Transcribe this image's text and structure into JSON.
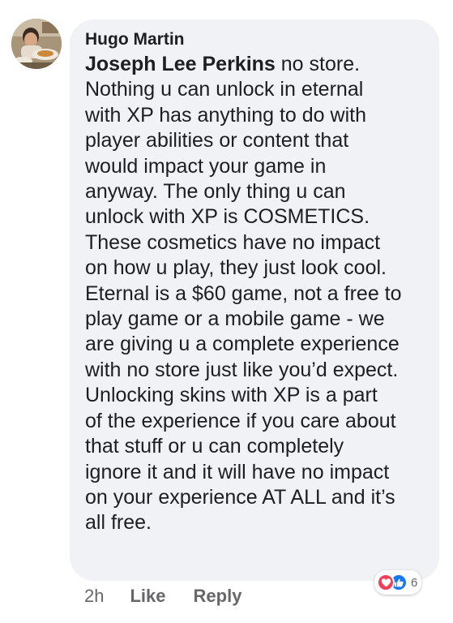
{
  "comment": {
    "author": "Hugo Martin",
    "mention": "Joseph Lee Perkins",
    "text": "  no store.\nNothing u can unlock in eternal\nwith XP has anything to do with\nplayer abilities or content that\nwould impact your game in\nanyway. The only thing u can\nunlock with XP is COSMETICS.\nThese cosmetics have no impact\non how u play, they just look cool.\nEternal is a $60 game, not a free to\nplay game or a mobile game - we\nare giving u a complete experience\nwith no store just like you’d expect.\nUnlocking skins with XP is a part\nof the experience if you care about\nthat stuff or u can completely\nignore it and it will have no impact\non your experience AT ALL and it’s\nall free."
  },
  "actions": {
    "time": "2h",
    "like_label": "Like",
    "reply_label": "Reply"
  },
  "reactions": {
    "count": "6",
    "icons": [
      "heart-icon",
      "thumbs-up-icon"
    ],
    "love_color": "#f33e58",
    "like_color": "#1877f2"
  },
  "colors": {
    "bubble_bg": "#f0f2f5",
    "text": "#1c1e21",
    "secondary_text": "#65676b"
  }
}
